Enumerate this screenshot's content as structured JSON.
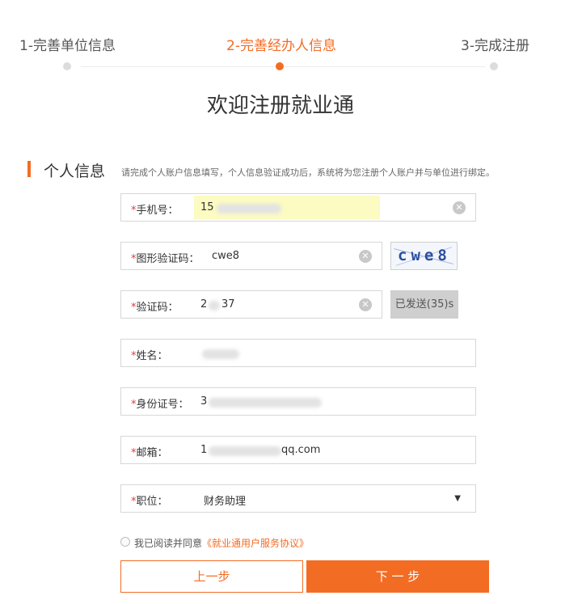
{
  "steps": [
    {
      "label": "1-完善单位信息"
    },
    {
      "label": "2-完善经办人信息"
    },
    {
      "label": "3-完成注册"
    }
  ],
  "page_title": "欢迎注册就业通",
  "section": {
    "title": "个人信息",
    "description": "请完成个人账户信息填写，个人信息验证成功后，系统将为您注册个人账户并与单位进行绑定。"
  },
  "form": {
    "required_mark": "*",
    "phone": {
      "label": "手机号：",
      "value": "15"
    },
    "captcha": {
      "label": "图形验证码：",
      "value": "cwe8",
      "image_text": "cwe8"
    },
    "sms_code": {
      "label": "验证码：",
      "value_prefix": "2",
      "value_suffix": "37",
      "send_button": "已发送(35)s"
    },
    "name": {
      "label": "姓名：",
      "value": ""
    },
    "id_number": {
      "label": "身份证号：",
      "value": "3"
    },
    "email": {
      "label": "邮箱：",
      "value_prefix": "1",
      "value_suffix": "qq.com"
    },
    "position": {
      "label": "职位：",
      "value": "财务助理",
      "arrow": "▼"
    }
  },
  "agreement": {
    "text": "我已阅读并同意",
    "link": "《就业通用户服务协议》"
  },
  "buttons": {
    "prev": "上一步",
    "next": "下 一 步"
  },
  "colors": {
    "accent": "#f36c24",
    "required": "#e4393c",
    "highlight": "#fbfbc2"
  },
  "icons": {
    "clear": "close-circle-icon",
    "dropdown": "triangle-down-icon"
  }
}
